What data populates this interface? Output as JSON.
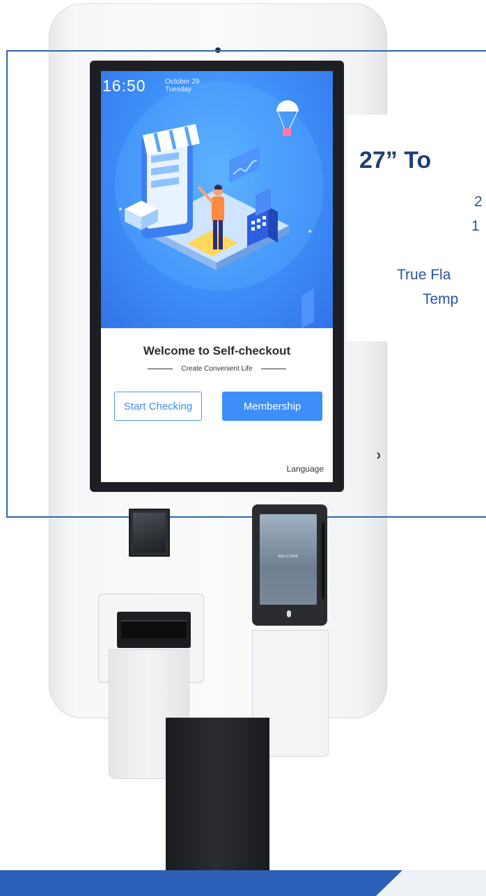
{
  "kiosk_screen": {
    "time": "16:50",
    "date_line1": "October 29",
    "date_line2": "Tuesday",
    "welcome_title": "Welcome to Self-checkout",
    "tagline": "Create Convenient Life",
    "start_button": "Start Checking",
    "membership_button": "Membership",
    "language_link": "Language"
  },
  "info_card": {
    "title": "27” To",
    "line1": "2",
    "line2": "1",
    "line3": "True Fla",
    "line4": "Temp"
  },
  "payment_terminal": {
    "screen_text": "WELCOME"
  },
  "colors": {
    "accent_blue": "#3d8ef8",
    "frame_blue": "#2f64b5",
    "title_navy": "#1e3f77",
    "bottom_bar": "#2b5fb8"
  }
}
